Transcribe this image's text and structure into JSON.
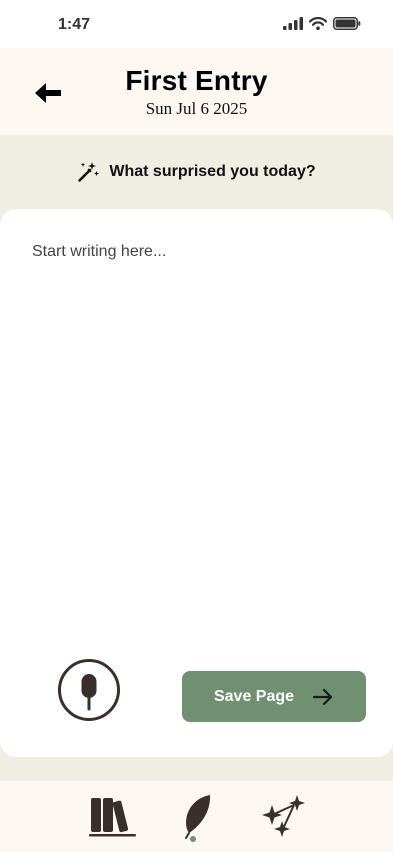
{
  "status": {
    "time": "1:47"
  },
  "header": {
    "title": "First Entry",
    "date": "Sun Jul 6 2025"
  },
  "prompt": {
    "text": "What surprised you today?"
  },
  "editor": {
    "placeholder": "Start writing here..."
  },
  "actions": {
    "save_label": "Save Page"
  },
  "colors": {
    "accent": "#6f9171",
    "header_bg": "#fcf8f1",
    "page_bg": "#f0ede3",
    "icon_dark": "#3a302b"
  },
  "tabs": [
    {
      "icon": "library-icon",
      "active": false
    },
    {
      "icon": "quill-icon",
      "active": true
    },
    {
      "icon": "sparkles-icon",
      "active": false
    }
  ]
}
